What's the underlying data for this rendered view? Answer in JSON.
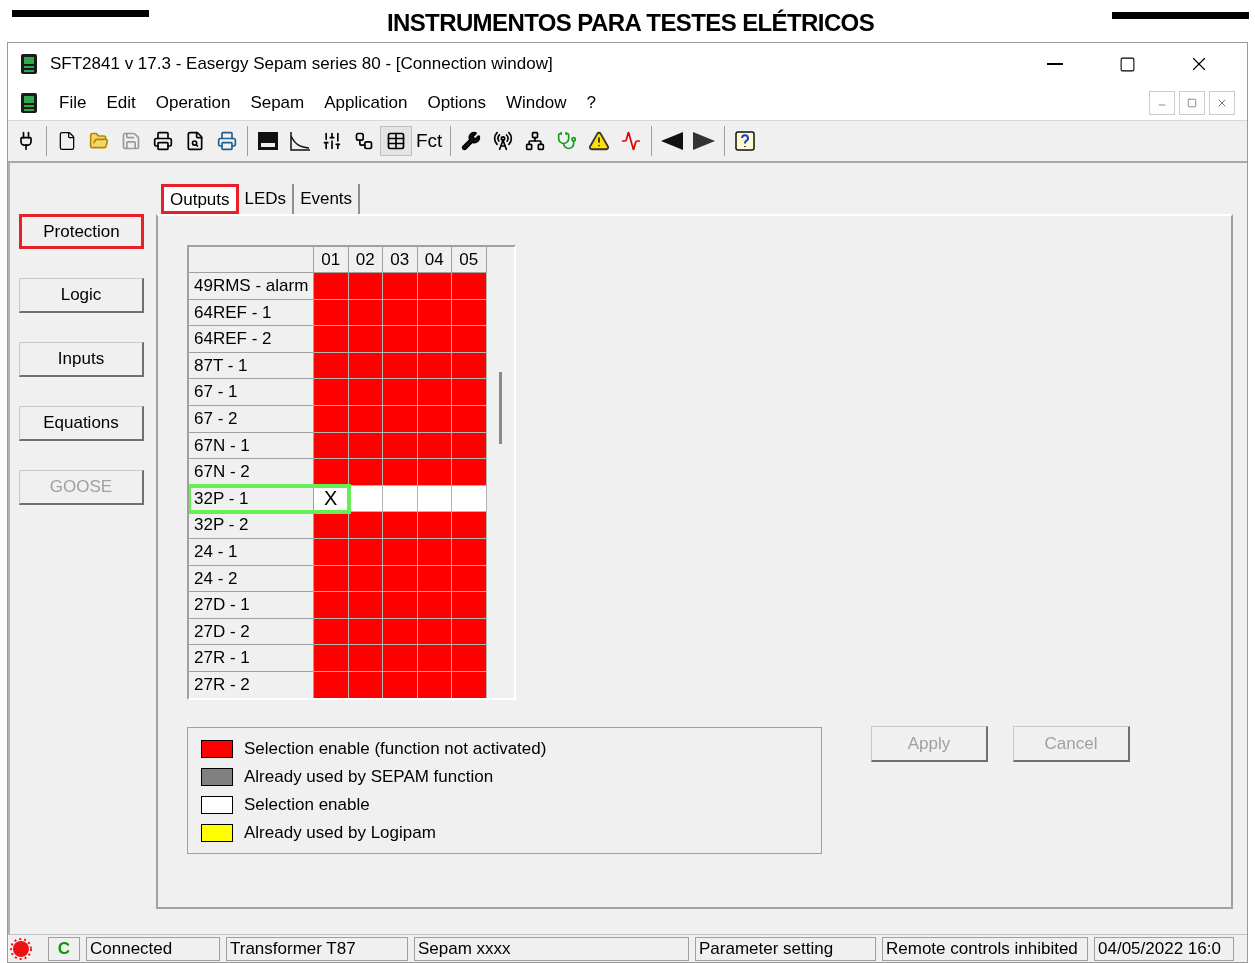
{
  "header": {
    "title": "INSTRUMENTOS PARA TESTES ELÉTRICOS"
  },
  "window": {
    "title": "SFT2841  v 17.3 - Easergy Sepam series 80 - [Connection window]"
  },
  "menu": [
    "File",
    "Edit",
    "Operation",
    "Sepam",
    "Application",
    "Options",
    "Window",
    "?"
  ],
  "toolbar": {
    "text_button": "Fct"
  },
  "side_buttons": [
    {
      "label": "Protection",
      "outlined": true,
      "disabled": false
    },
    {
      "label": "Logic",
      "outlined": false,
      "disabled": false
    },
    {
      "label": "Inputs",
      "outlined": false,
      "disabled": false
    },
    {
      "label": "Equations",
      "outlined": false,
      "disabled": false
    },
    {
      "label": "GOOSE",
      "outlined": false,
      "disabled": true
    }
  ],
  "tabs": [
    {
      "label": "Outputs",
      "selected": true,
      "outlined": true
    },
    {
      "label": "LEDs",
      "selected": false,
      "outlined": false
    },
    {
      "label": "Events",
      "selected": false,
      "outlined": false
    }
  ],
  "table": {
    "columns": [
      "01",
      "02",
      "03",
      "04",
      "05"
    ],
    "rows": [
      {
        "label": "49RMS - alarm",
        "outlined": false,
        "cells": [
          {
            "kind": "inactive"
          },
          {
            "kind": "inactive"
          },
          {
            "kind": "inactive"
          },
          {
            "kind": "inactive"
          },
          {
            "kind": "inactive"
          }
        ]
      },
      {
        "label": "64REF - 1",
        "outlined": false,
        "cells": [
          {
            "kind": "inactive"
          },
          {
            "kind": "inactive"
          },
          {
            "kind": "inactive"
          },
          {
            "kind": "inactive"
          },
          {
            "kind": "inactive"
          }
        ]
      },
      {
        "label": "64REF - 2",
        "outlined": false,
        "cells": [
          {
            "kind": "inactive"
          },
          {
            "kind": "inactive"
          },
          {
            "kind": "inactive"
          },
          {
            "kind": "inactive"
          },
          {
            "kind": "inactive"
          }
        ]
      },
      {
        "label": "87T - 1",
        "outlined": false,
        "cells": [
          {
            "kind": "inactive"
          },
          {
            "kind": "inactive"
          },
          {
            "kind": "inactive"
          },
          {
            "kind": "inactive"
          },
          {
            "kind": "inactive"
          }
        ]
      },
      {
        "label": "67 - 1",
        "outlined": false,
        "cells": [
          {
            "kind": "inactive"
          },
          {
            "kind": "inactive"
          },
          {
            "kind": "inactive"
          },
          {
            "kind": "inactive"
          },
          {
            "kind": "inactive"
          }
        ]
      },
      {
        "label": "67 - 2",
        "outlined": false,
        "cells": [
          {
            "kind": "inactive"
          },
          {
            "kind": "inactive"
          },
          {
            "kind": "inactive"
          },
          {
            "kind": "inactive"
          },
          {
            "kind": "inactive"
          }
        ]
      },
      {
        "label": "67N - 1",
        "outlined": false,
        "cells": [
          {
            "kind": "inactive"
          },
          {
            "kind": "inactive"
          },
          {
            "kind": "inactive"
          },
          {
            "kind": "inactive"
          },
          {
            "kind": "inactive"
          }
        ]
      },
      {
        "label": "67N - 2",
        "outlined": false,
        "cells": [
          {
            "kind": "inactive"
          },
          {
            "kind": "inactive"
          },
          {
            "kind": "inactive"
          },
          {
            "kind": "inactive"
          },
          {
            "kind": "inactive"
          }
        ]
      },
      {
        "label": "32P - 1",
        "outlined": true,
        "cells": [
          {
            "kind": "enable",
            "mark": "X"
          },
          {
            "kind": "enable"
          },
          {
            "kind": "enable"
          },
          {
            "kind": "enable"
          },
          {
            "kind": "enable"
          }
        ]
      },
      {
        "label": "32P - 2",
        "outlined": false,
        "cells": [
          {
            "kind": "inactive"
          },
          {
            "kind": "inactive"
          },
          {
            "kind": "inactive"
          },
          {
            "kind": "inactive"
          },
          {
            "kind": "inactive"
          }
        ]
      },
      {
        "label": "24 - 1",
        "outlined": false,
        "cells": [
          {
            "kind": "inactive"
          },
          {
            "kind": "inactive"
          },
          {
            "kind": "inactive"
          },
          {
            "kind": "inactive"
          },
          {
            "kind": "inactive"
          }
        ]
      },
      {
        "label": "24 - 2",
        "outlined": false,
        "cells": [
          {
            "kind": "inactive"
          },
          {
            "kind": "inactive"
          },
          {
            "kind": "inactive"
          },
          {
            "kind": "inactive"
          },
          {
            "kind": "inactive"
          }
        ]
      },
      {
        "label": "27D - 1",
        "outlined": false,
        "cells": [
          {
            "kind": "inactive"
          },
          {
            "kind": "inactive"
          },
          {
            "kind": "inactive"
          },
          {
            "kind": "inactive"
          },
          {
            "kind": "inactive"
          }
        ]
      },
      {
        "label": "27D - 2",
        "outlined": false,
        "cells": [
          {
            "kind": "inactive"
          },
          {
            "kind": "inactive"
          },
          {
            "kind": "inactive"
          },
          {
            "kind": "inactive"
          },
          {
            "kind": "inactive"
          }
        ]
      },
      {
        "label": "27R - 1",
        "outlined": false,
        "cells": [
          {
            "kind": "inactive"
          },
          {
            "kind": "inactive"
          },
          {
            "kind": "inactive"
          },
          {
            "kind": "inactive"
          },
          {
            "kind": "inactive"
          }
        ]
      },
      {
        "label": "27R - 2",
        "outlined": false,
        "cells": [
          {
            "kind": "inactive"
          },
          {
            "kind": "inactive"
          },
          {
            "kind": "inactive"
          },
          {
            "kind": "inactive"
          },
          {
            "kind": "inactive"
          }
        ]
      }
    ]
  },
  "legend": [
    {
      "color": "#ff0000",
      "label": "Selection enable (function not activated)"
    },
    {
      "color": "#808080",
      "label": "Already used by SEPAM function"
    },
    {
      "color": "#ffffff",
      "label": "Selection enable"
    },
    {
      "color": "#ffff00",
      "label": "Already used by Logipam"
    }
  ],
  "buttons": [
    {
      "label": "Apply",
      "disabled": true
    },
    {
      "label": "Cancel",
      "disabled": true
    }
  ],
  "status_bar": {
    "connection_icon": "C",
    "fields": [
      "Connected",
      "Transformer T87",
      "Sepam xxxx",
      "Parameter setting",
      "Remote controls inhibited",
      "04/05/2022  16:0"
    ]
  }
}
